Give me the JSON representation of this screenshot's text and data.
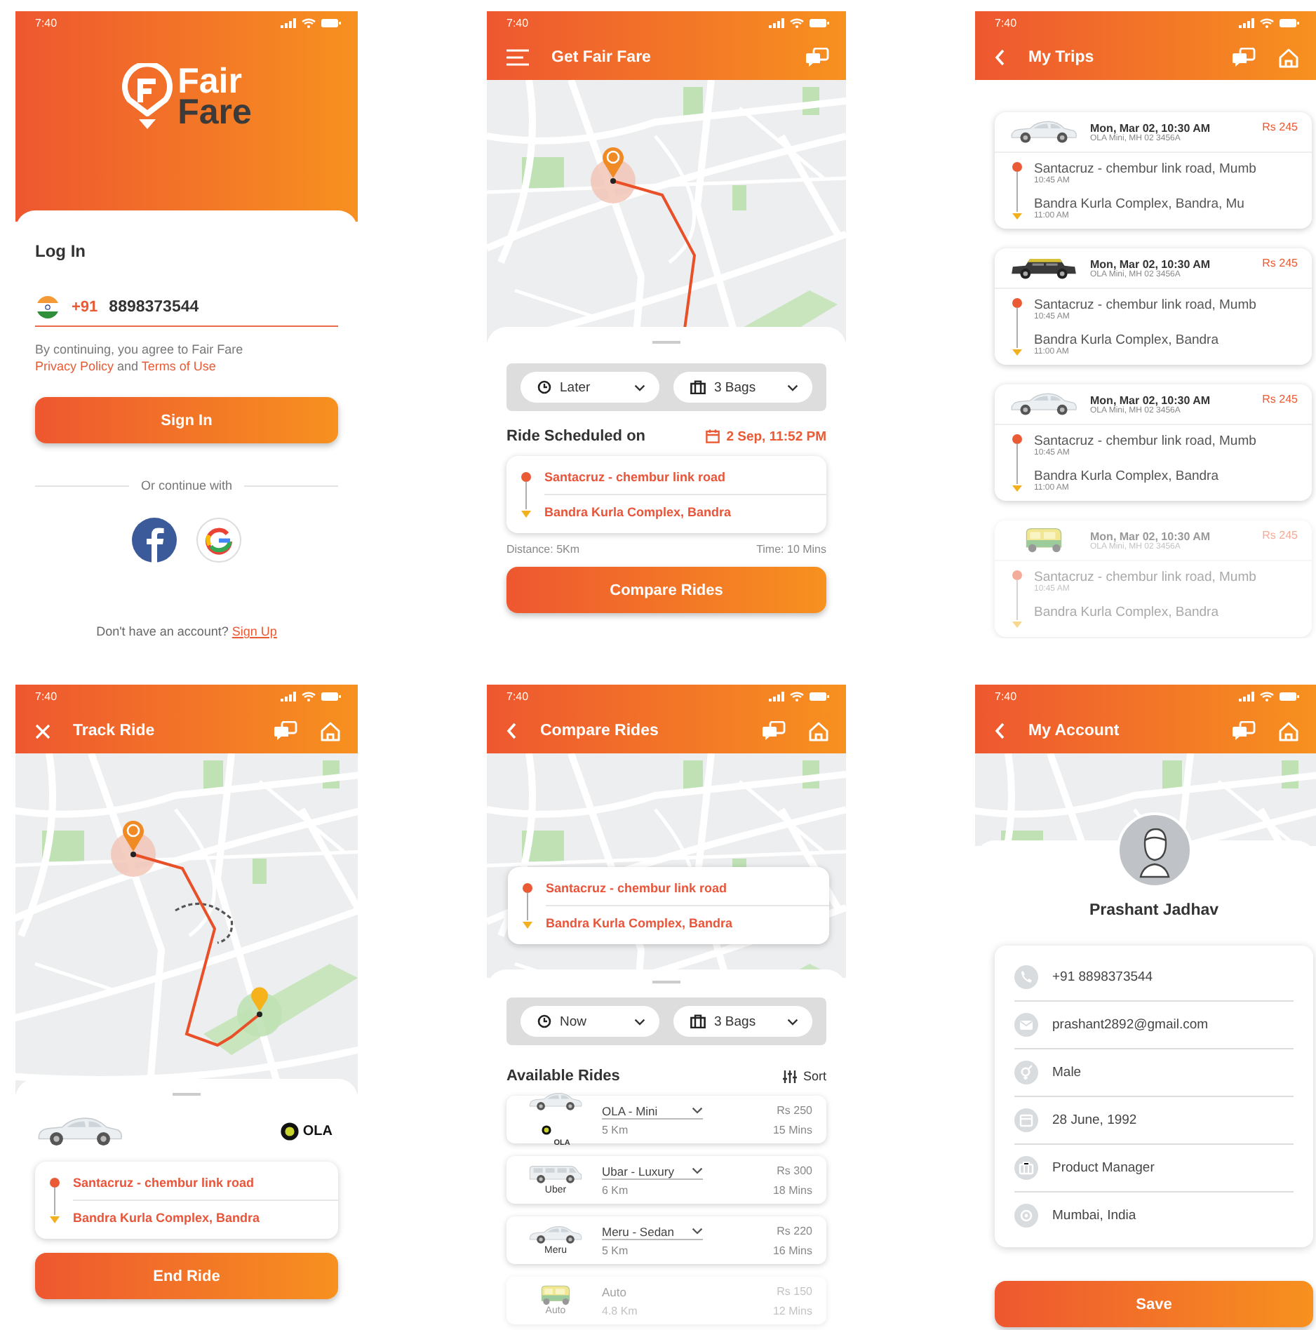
{
  "login": {
    "time": "7:40",
    "logo": [
      "Fair",
      "Fare"
    ],
    "heading": "Log In",
    "phone": {
      "code": "+91",
      "value": "8898373544"
    },
    "consent": {
      "text": "By continuing, you agree to Fair Fare",
      "privacy": "Privacy Policy",
      "and": "and",
      "terms": "Terms of Use"
    },
    "button": "Sign In",
    "divider": "Or continue with",
    "signup": {
      "prompt": "Don't have an account?",
      "link": "Sign Up"
    }
  },
  "get_fare": {
    "time": "7:40",
    "title": "Get Fair Fare",
    "selectors": [
      {
        "kind": "time",
        "label": "Later"
      },
      {
        "kind": "bags",
        "label": "3 Bags"
      }
    ],
    "scheduled": {
      "label": "Ride Scheduled on",
      "value": "2 Sep, 11:52 PM"
    },
    "route": {
      "from": "Santacruz - chembur link road",
      "to": "Bandra Kurla Complex, Bandra"
    },
    "distance": "Distance: 5Km",
    "duration": "Time: 10 Mins",
    "button": "Compare Rides"
  },
  "my_trips": {
    "time": "7:40",
    "title": "My Trips",
    "trips": [
      {
        "vehicle": {
          "kind": "car"
        },
        "date": "Mon, Mar 02, 10:30 AM",
        "details": "OLA Mini, MH 02 3456A",
        "price": "Rs 245",
        "from": "Santacruz - chembur link road, Mumb",
        "from_time": "10:45 AM",
        "to": "Bandra Kurla Complex, Bandra, Mu",
        "to_time": "11:00 AM",
        "faded": false
      },
      {
        "vehicle": {
          "kind": "taxi"
        },
        "date": "Mon, Mar 02, 10:30 AM",
        "details": "OLA Mini, MH 02 3456A",
        "price": "Rs 245",
        "from": "Santacruz - chembur link road, Mumb",
        "from_time": "10:45 AM",
        "to": "Bandra Kurla Complex, Bandra",
        "to_time": "11:00 AM",
        "faded": false
      },
      {
        "vehicle": {
          "kind": "car"
        },
        "date": "Mon, Mar 02, 10:30 AM",
        "details": "OLA Mini, MH 02 3456A",
        "price": "Rs 245",
        "from": "Santacruz - chembur link road, Mumb",
        "from_time": "10:45 AM",
        "to": "Bandra Kurla Complex, Bandra",
        "to_time": "11:00 AM",
        "faded": false
      },
      {
        "vehicle": {
          "kind": "auto"
        },
        "date": "Mon, Mar 02, 10:30 AM",
        "details": "OLA Mini, MH 02 3456A",
        "price": "Rs 245",
        "from": "Santacruz - chembur link road, Mumb",
        "from_time": "10:45 AM",
        "to": "Bandra Kurla Complex, Bandra",
        "faded": true
      }
    ]
  },
  "track_ride": {
    "time": "7:40",
    "title": "Track Ride",
    "vehicle": {
      "kind": "car"
    },
    "provider": "OLA",
    "route": {
      "from": "Santacruz - chembur link road",
      "to": "Bandra Kurla Complex, Bandra"
    },
    "button": "End Ride"
  },
  "compare_rides": {
    "time": "7:40",
    "title": "Compare Rides",
    "route": {
      "from": "Santacruz - chembur link road",
      "to": "Bandra Kurla Complex, Bandra"
    },
    "selectors": [
      {
        "kind": "time",
        "label": "Now"
      },
      {
        "kind": "bags",
        "label": "3 Bags"
      }
    ],
    "heading": "Available Rides",
    "sort": "Sort",
    "rides": [
      {
        "vehicle": {
          "kind": "car"
        },
        "brand": "OLA",
        "brand_logo": true,
        "name": "OLA - Mini",
        "dropdown": true,
        "distance": "5 Km",
        "price": "Rs 250",
        "duration": "15 Mins",
        "faded": false
      },
      {
        "vehicle": {
          "kind": "van"
        },
        "brand": "Uber",
        "brand_logo": false,
        "name": "Ubar - Luxury",
        "dropdown": true,
        "distance": "6 Km",
        "price": "Rs 300",
        "duration": "18 Mins",
        "faded": false
      },
      {
        "vehicle": {
          "kind": "car"
        },
        "brand": "Meru",
        "brand_logo": false,
        "name": "Meru - Sedan",
        "dropdown": true,
        "distance": "5 Km",
        "price": "Rs 220",
        "duration": "16 Mins",
        "faded": false
      },
      {
        "vehicle": {
          "kind": "auto"
        },
        "brand": "Auto",
        "brand_logo": false,
        "name": "Auto",
        "dropdown": false,
        "distance": "4.8 Km",
        "price": "Rs 150",
        "duration": "12 Mins",
        "faded": true
      }
    ]
  },
  "my_account": {
    "time": "7:40",
    "title": "My Account",
    "name": "Prashant Jadhav",
    "fields": [
      {
        "kind": "phone",
        "value": "+91 8898373544"
      },
      {
        "kind": "email",
        "value": "prashant2892@gmail.com"
      },
      {
        "kind": "gender",
        "value": "Male"
      },
      {
        "kind": "date",
        "value": "28 June, 1992"
      },
      {
        "kind": "work",
        "value": "Product Manager"
      },
      {
        "kind": "location",
        "value": "Mumbai, India"
      }
    ],
    "button": "Save"
  }
}
